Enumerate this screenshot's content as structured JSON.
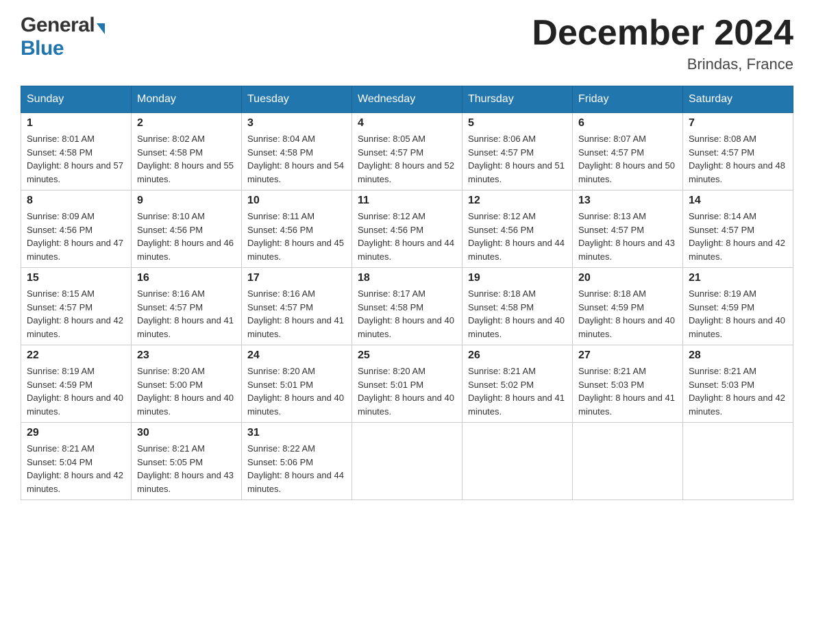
{
  "header": {
    "logo_general": "General",
    "logo_blue": "Blue",
    "month_title": "December 2024",
    "location": "Brindas, France"
  },
  "days_of_week": [
    "Sunday",
    "Monday",
    "Tuesday",
    "Wednesday",
    "Thursday",
    "Friday",
    "Saturday"
  ],
  "weeks": [
    [
      {
        "day": "1",
        "sunrise": "8:01 AM",
        "sunset": "4:58 PM",
        "daylight": "8 hours and 57 minutes."
      },
      {
        "day": "2",
        "sunrise": "8:02 AM",
        "sunset": "4:58 PM",
        "daylight": "8 hours and 55 minutes."
      },
      {
        "day": "3",
        "sunrise": "8:04 AM",
        "sunset": "4:58 PM",
        "daylight": "8 hours and 54 minutes."
      },
      {
        "day": "4",
        "sunrise": "8:05 AM",
        "sunset": "4:57 PM",
        "daylight": "8 hours and 52 minutes."
      },
      {
        "day": "5",
        "sunrise": "8:06 AM",
        "sunset": "4:57 PM",
        "daylight": "8 hours and 51 minutes."
      },
      {
        "day": "6",
        "sunrise": "8:07 AM",
        "sunset": "4:57 PM",
        "daylight": "8 hours and 50 minutes."
      },
      {
        "day": "7",
        "sunrise": "8:08 AM",
        "sunset": "4:57 PM",
        "daylight": "8 hours and 48 minutes."
      }
    ],
    [
      {
        "day": "8",
        "sunrise": "8:09 AM",
        "sunset": "4:56 PM",
        "daylight": "8 hours and 47 minutes."
      },
      {
        "day": "9",
        "sunrise": "8:10 AM",
        "sunset": "4:56 PM",
        "daylight": "8 hours and 46 minutes."
      },
      {
        "day": "10",
        "sunrise": "8:11 AM",
        "sunset": "4:56 PM",
        "daylight": "8 hours and 45 minutes."
      },
      {
        "day": "11",
        "sunrise": "8:12 AM",
        "sunset": "4:56 PM",
        "daylight": "8 hours and 44 minutes."
      },
      {
        "day": "12",
        "sunrise": "8:12 AM",
        "sunset": "4:56 PM",
        "daylight": "8 hours and 44 minutes."
      },
      {
        "day": "13",
        "sunrise": "8:13 AM",
        "sunset": "4:57 PM",
        "daylight": "8 hours and 43 minutes."
      },
      {
        "day": "14",
        "sunrise": "8:14 AM",
        "sunset": "4:57 PM",
        "daylight": "8 hours and 42 minutes."
      }
    ],
    [
      {
        "day": "15",
        "sunrise": "8:15 AM",
        "sunset": "4:57 PM",
        "daylight": "8 hours and 42 minutes."
      },
      {
        "day": "16",
        "sunrise": "8:16 AM",
        "sunset": "4:57 PM",
        "daylight": "8 hours and 41 minutes."
      },
      {
        "day": "17",
        "sunrise": "8:16 AM",
        "sunset": "4:57 PM",
        "daylight": "8 hours and 41 minutes."
      },
      {
        "day": "18",
        "sunrise": "8:17 AM",
        "sunset": "4:58 PM",
        "daylight": "8 hours and 40 minutes."
      },
      {
        "day": "19",
        "sunrise": "8:18 AM",
        "sunset": "4:58 PM",
        "daylight": "8 hours and 40 minutes."
      },
      {
        "day": "20",
        "sunrise": "8:18 AM",
        "sunset": "4:59 PM",
        "daylight": "8 hours and 40 minutes."
      },
      {
        "day": "21",
        "sunrise": "8:19 AM",
        "sunset": "4:59 PM",
        "daylight": "8 hours and 40 minutes."
      }
    ],
    [
      {
        "day": "22",
        "sunrise": "8:19 AM",
        "sunset": "4:59 PM",
        "daylight": "8 hours and 40 minutes."
      },
      {
        "day": "23",
        "sunrise": "8:20 AM",
        "sunset": "5:00 PM",
        "daylight": "8 hours and 40 minutes."
      },
      {
        "day": "24",
        "sunrise": "8:20 AM",
        "sunset": "5:01 PM",
        "daylight": "8 hours and 40 minutes."
      },
      {
        "day": "25",
        "sunrise": "8:20 AM",
        "sunset": "5:01 PM",
        "daylight": "8 hours and 40 minutes."
      },
      {
        "day": "26",
        "sunrise": "8:21 AM",
        "sunset": "5:02 PM",
        "daylight": "8 hours and 41 minutes."
      },
      {
        "day": "27",
        "sunrise": "8:21 AM",
        "sunset": "5:03 PM",
        "daylight": "8 hours and 41 minutes."
      },
      {
        "day": "28",
        "sunrise": "8:21 AM",
        "sunset": "5:03 PM",
        "daylight": "8 hours and 42 minutes."
      }
    ],
    [
      {
        "day": "29",
        "sunrise": "8:21 AM",
        "sunset": "5:04 PM",
        "daylight": "8 hours and 42 minutes."
      },
      {
        "day": "30",
        "sunrise": "8:21 AM",
        "sunset": "5:05 PM",
        "daylight": "8 hours and 43 minutes."
      },
      {
        "day": "31",
        "sunrise": "8:22 AM",
        "sunset": "5:06 PM",
        "daylight": "8 hours and 44 minutes."
      },
      null,
      null,
      null,
      null
    ]
  ],
  "labels": {
    "sunrise": "Sunrise:",
    "sunset": "Sunset:",
    "daylight": "Daylight:"
  }
}
